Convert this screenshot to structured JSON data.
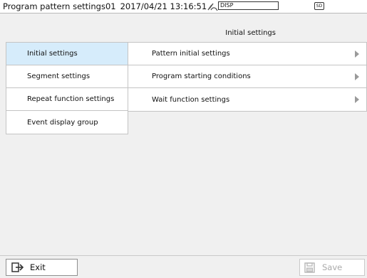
{
  "title_bar": {
    "title": "Program pattern settings01",
    "datetime": "2017/04/21 13:16:51",
    "disp_label": "DISP",
    "sd_label": "SD"
  },
  "header": {
    "title": "Initial settings"
  },
  "left_menu": {
    "items": [
      {
        "label": "Initial settings",
        "active": true
      },
      {
        "label": "Segment settings",
        "active": false
      },
      {
        "label": "Repeat function settings",
        "active": false
      },
      {
        "label": "Event display group",
        "active": false
      }
    ]
  },
  "right_list": {
    "items": [
      {
        "label": "Pattern initial settings"
      },
      {
        "label": "Program starting conditions"
      },
      {
        "label": "Wait function settings"
      }
    ]
  },
  "footer": {
    "exit_label": "Exit",
    "save_label": "Save"
  },
  "colors": {
    "active_bg": "#d6ecfb",
    "panel_bg": "#f0f0f0",
    "disabled_text": "#aaaaaa"
  },
  "icons": {
    "antenna": "antenna-icon",
    "sd": "sd-card-icon",
    "exit": "exit-icon",
    "save": "save-icon",
    "chevron": "chevron-right-icon"
  }
}
